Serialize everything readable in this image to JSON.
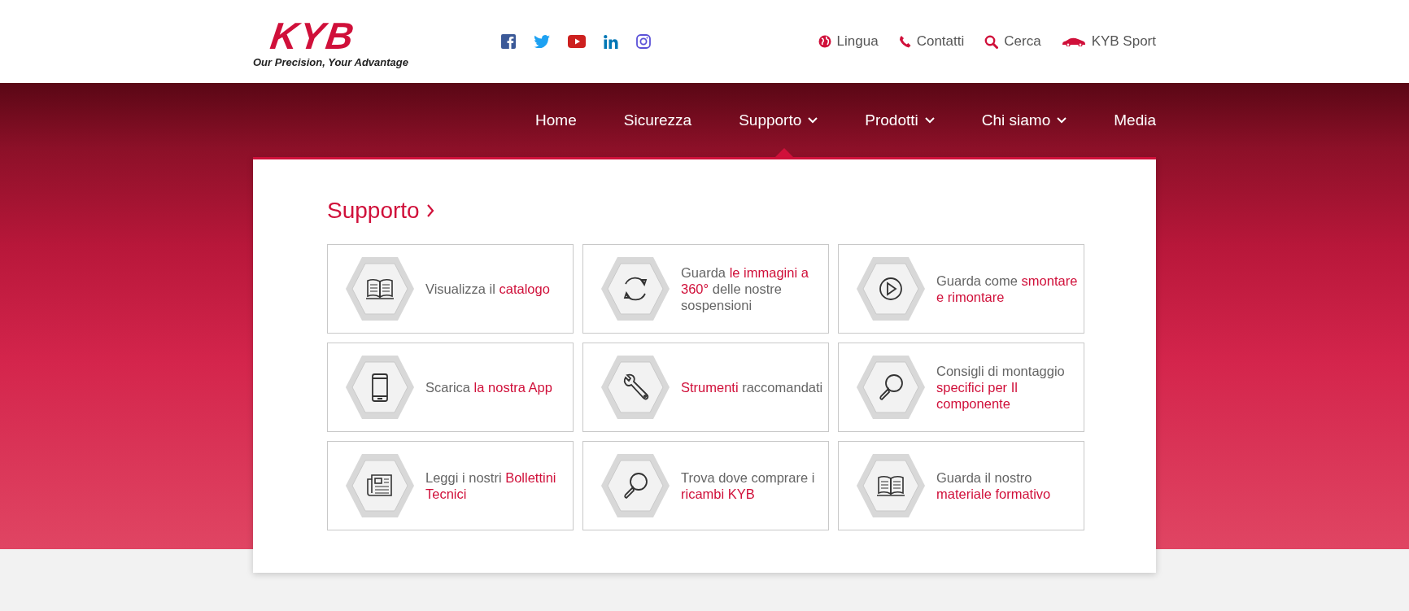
{
  "logo": {
    "text": "KYB",
    "tagline": "Our Precision, Your Advantage"
  },
  "top_links": [
    {
      "kind": "globe",
      "label": "Lingua"
    },
    {
      "kind": "phone",
      "label": "Contatti"
    },
    {
      "kind": "search",
      "label": "Cerca"
    },
    {
      "kind": "car",
      "label": "KYB Sport"
    }
  ],
  "nav": [
    {
      "label": "Home",
      "dropdown": false,
      "selected": false
    },
    {
      "label": "Sicurezza",
      "dropdown": false,
      "selected": false
    },
    {
      "label": "Supporto",
      "dropdown": true,
      "selected": true
    },
    {
      "label": "Prodotti",
      "dropdown": true,
      "selected": false
    },
    {
      "label": "Chi siamo",
      "dropdown": true,
      "selected": false
    },
    {
      "label": "Media",
      "dropdown": false,
      "selected": false
    }
  ],
  "panel": {
    "title": "Supporto",
    "cards": [
      {
        "kind": "book",
        "parts": [
          {
            "text": "Visualizza il ",
            "highlight": false
          },
          {
            "text": "catalogo",
            "highlight": true
          }
        ]
      },
      {
        "kind": "rotate",
        "parts": [
          {
            "text": "Guarda ",
            "highlight": false
          },
          {
            "text": "le immagini a 360°",
            "highlight": true
          },
          {
            "text": " delle nostre sospensioni",
            "highlight": false
          }
        ]
      },
      {
        "kind": "play",
        "parts": [
          {
            "text": "Guarda come ",
            "highlight": false
          },
          {
            "text": "smontare e rimontare",
            "highlight": true
          }
        ]
      },
      {
        "kind": "phone",
        "parts": [
          {
            "text": "Scarica ",
            "highlight": false
          },
          {
            "text": "la nostra App",
            "highlight": true
          }
        ]
      },
      {
        "kind": "wrench",
        "parts": [
          {
            "text": "Strumenti",
            "highlight": true
          },
          {
            "text": " raccomandati",
            "highlight": false
          }
        ]
      },
      {
        "kind": "magnifier",
        "parts": [
          {
            "text": "Consigli di montaggio ",
            "highlight": false
          },
          {
            "text": "specifici per Il componente",
            "highlight": true
          }
        ]
      },
      {
        "kind": "newspaper",
        "parts": [
          {
            "text": "Leggi i nostri ",
            "highlight": false
          },
          {
            "text": "Bollettini Tecnici",
            "highlight": true
          }
        ]
      },
      {
        "kind": "magnifier",
        "parts": [
          {
            "text": "Trova dove comprare i ",
            "highlight": false
          },
          {
            "text": "ricambi KYB",
            "highlight": true
          }
        ]
      },
      {
        "kind": "book",
        "parts": [
          {
            "text": "Guarda il nostro ",
            "highlight": false
          },
          {
            "text": "materiale formativo",
            "highlight": true
          }
        ]
      }
    ]
  }
}
